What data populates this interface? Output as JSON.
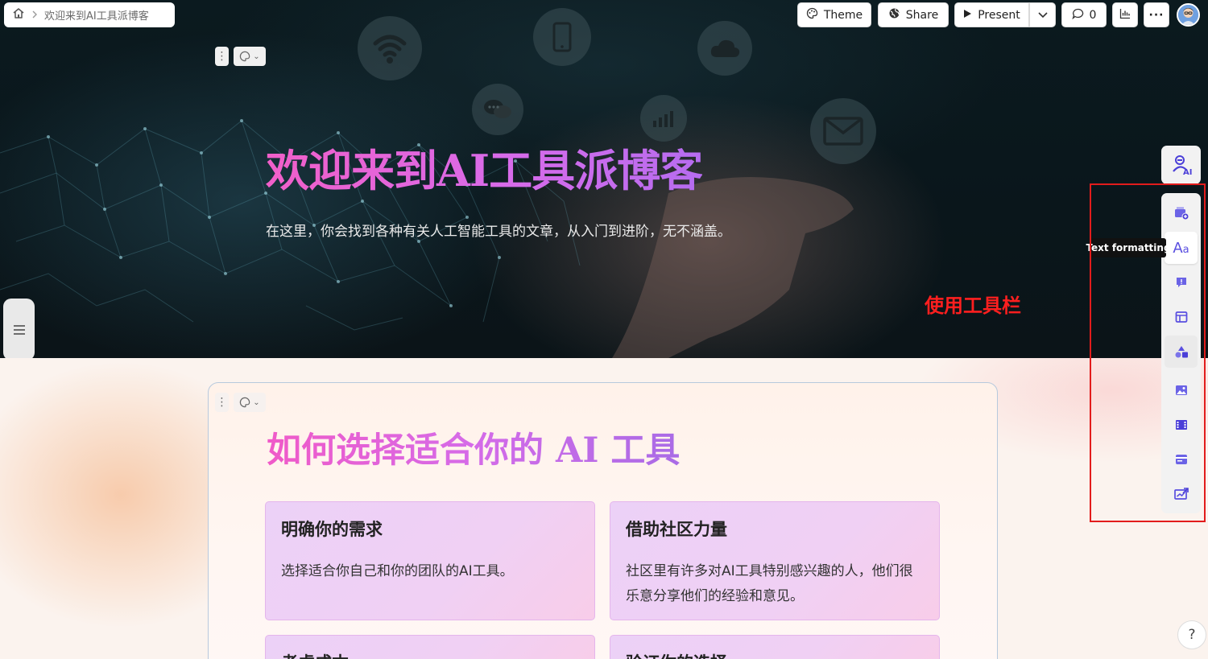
{
  "breadcrumb": {
    "title": "欢迎来到AI工具派博客"
  },
  "toolbar": {
    "theme_label": "Theme",
    "share_label": "Share",
    "present_label": "Present",
    "comments_count": "0"
  },
  "hero": {
    "title": "欢迎来到AI工具派博客",
    "subtitle": "在这里，你会找到各种有关人工智能工具的文章，从入门到进阶，无不涵盖。",
    "annotation": "使用工具栏"
  },
  "section": {
    "title": "如何选择适合你的 AI 工具",
    "cards": [
      {
        "heading": "明确你的需求",
        "text": "选择适合你自己和你的团队的AI工具。"
      },
      {
        "heading": "借助社区力量",
        "text": "社区里有许多对AI工具特别感兴趣的人，他们很乐意分享他们的经验和意见。"
      },
      {
        "heading": "考虑成本",
        "text": ""
      },
      {
        "heading": "验证你的选择",
        "text": ""
      }
    ]
  },
  "right_toolbar": {
    "ai_label": "AI",
    "tooltip": "Text formatting",
    "items": [
      "add-card-icon",
      "text-formatting-icon",
      "callout-icon",
      "layout-icon",
      "shapes-icon",
      "image-icon",
      "video-icon",
      "embed-icon",
      "chart-icon"
    ]
  },
  "help_label": "?",
  "colors": {
    "accent": "#7b5cf0",
    "title_pink": "#f15fc9",
    "annotation_red": "#ff1f1f"
  }
}
